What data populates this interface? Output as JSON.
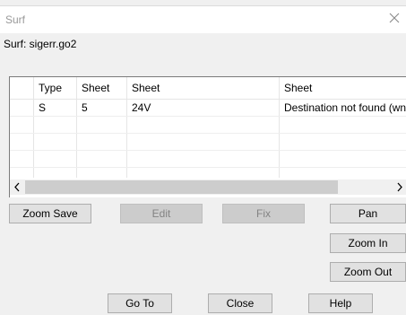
{
  "window": {
    "title": "Surf",
    "close_icon": "close-icon"
  },
  "file": {
    "label": "Surf: sigerr.go2"
  },
  "table": {
    "columns": [
      "Type",
      "Sheet",
      "Sheet",
      "Sheet"
    ],
    "rows": [
      [
        "S",
        "5",
        "24V",
        "Destination not found (wne"
      ]
    ]
  },
  "scrollbar": {
    "left_icon": "chevron-left-icon",
    "right_icon": "chevron-right-icon"
  },
  "buttons": {
    "zoom_save": "Zoom Save",
    "edit": "Edit",
    "fix": "Fix",
    "pan": "Pan",
    "zoom_in": "Zoom In",
    "zoom_out": "Zoom Out",
    "go_to": "Go To",
    "close": "Close",
    "help": "Help"
  },
  "colors": {
    "disabled_bg": "#cccccc",
    "disabled_text": "#838383",
    "button_bg": "#e1e1e1"
  }
}
